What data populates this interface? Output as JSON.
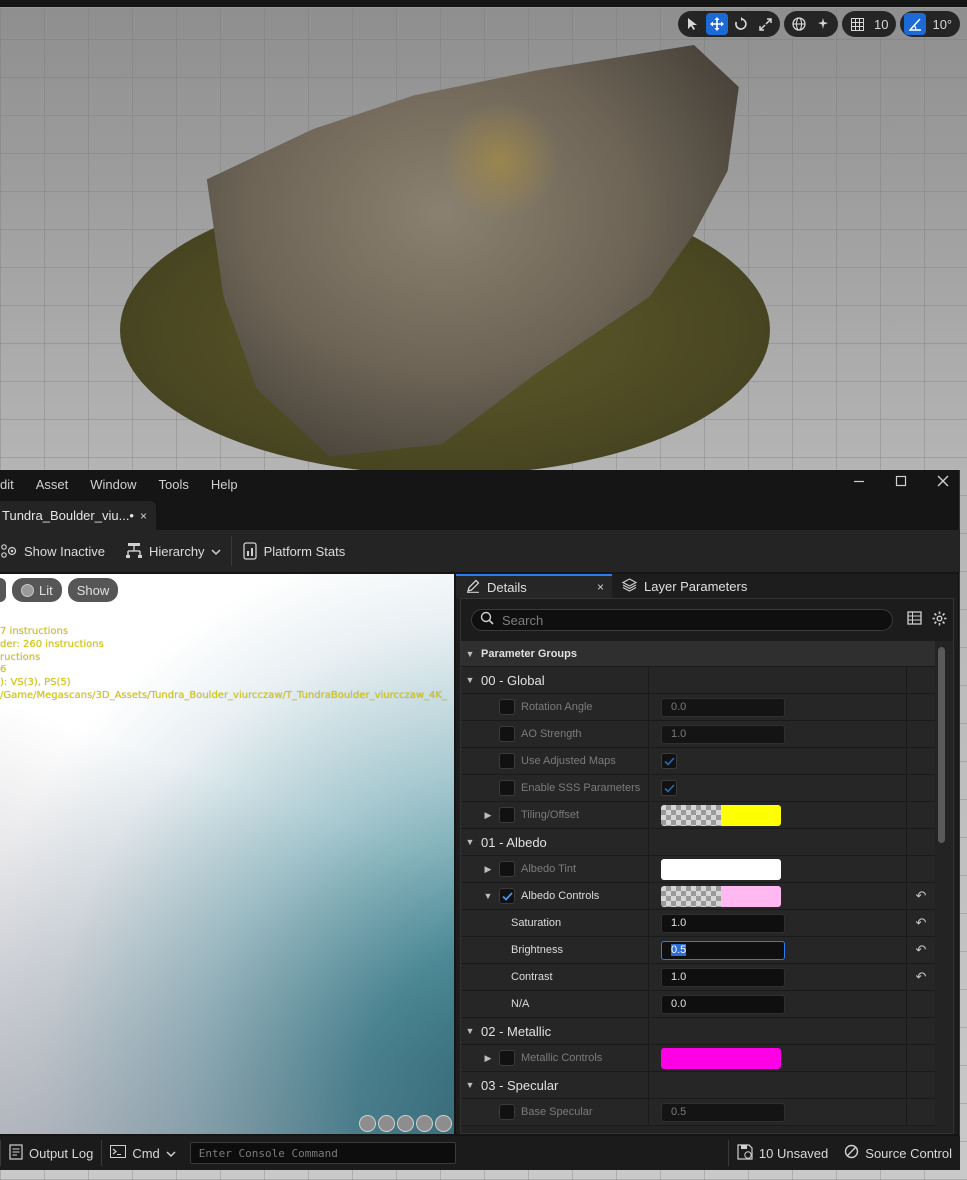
{
  "viewport_toolbar": {
    "grid_snap_value": "10",
    "rotation_snap_value": "10°"
  },
  "menu": {
    "items": [
      "dit",
      "Asset",
      "Window",
      "Tools",
      "Help"
    ]
  },
  "tab": {
    "title": "Tundra_Boulder_viu...•",
    "close": "×"
  },
  "toolbar": {
    "show_inactive": "Show Inactive",
    "hierarchy": "Hierarchy",
    "platform_stats": "Platform Stats"
  },
  "preview": {
    "lit_label": "Lit",
    "show_label": "Show",
    "stats": [
      "7 instructions",
      "der: 260 instructions",
      "ructions",
      "6",
      "): VS(3), PS(5)",
      " /Game/Megascans/3D_Assets/Tundra_Boulder_viurcczaw/T_TundraBoulder_viurcczaw_4K_"
    ]
  },
  "details": {
    "tab_details": "Details",
    "tab_close": "×",
    "tab_layer": "Layer Parameters",
    "search_placeholder": "Search",
    "header": "Parameter Groups",
    "groups": {
      "global": "00 - Global",
      "albedo": "01 - Albedo",
      "metallic": "02 - Metallic",
      "specular": "03 - Specular"
    },
    "props": {
      "rotation_angle": {
        "label": "Rotation Angle",
        "value": "0.0"
      },
      "ao_strength": {
        "label": "AO Strength",
        "value": "1.0"
      },
      "use_adjusted_maps": {
        "label": "Use Adjusted Maps"
      },
      "enable_sss": {
        "label": "Enable SSS Parameters"
      },
      "tiling_offset": {
        "label": "Tiling/Offset",
        "color": "#ffff00"
      },
      "albedo_tint": {
        "label": "Albedo Tint",
        "color": "#ffffff"
      },
      "albedo_controls": {
        "label": "Albedo Controls",
        "color": "#ffb8f0"
      },
      "saturation": {
        "label": "Saturation",
        "value": "1.0"
      },
      "brightness": {
        "label": "Brightness",
        "value": "0.5"
      },
      "contrast": {
        "label": "Contrast",
        "value": "1.0"
      },
      "na": {
        "label": "N/A",
        "value": "0.0"
      },
      "metallic_controls": {
        "label": "Metallic Controls",
        "color": "#ff00e6"
      },
      "base_specular": {
        "label": "Base Specular",
        "value": "0.5"
      }
    }
  },
  "statusbar": {
    "output_log": "Output Log",
    "cmd": "Cmd",
    "console_placeholder": "Enter Console Command",
    "unsaved": "10 Unsaved",
    "source_control": "Source Control"
  },
  "colors": {
    "accent": "#2b7bf3",
    "stats_text": "#d8c800"
  }
}
